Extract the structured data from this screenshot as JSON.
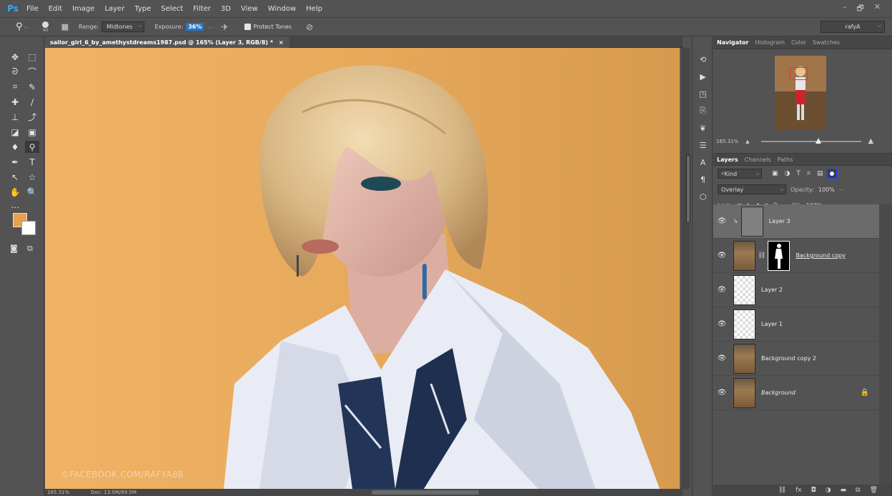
{
  "app": {
    "logo": "Ps"
  },
  "menu": [
    "File",
    "Edit",
    "Image",
    "Layer",
    "Type",
    "Select",
    "Filter",
    "3D",
    "View",
    "Window",
    "Help"
  ],
  "window_controls": [
    "–",
    "🗗",
    "✕"
  ],
  "options": {
    "brush_size": "40",
    "range_label": "Range:",
    "range_value": "Midtones",
    "exposure_label": "Exposure:",
    "exposure_value": "36%",
    "protect_tones": "Protect Tones",
    "workspace": "rafyA"
  },
  "document": {
    "tab_title": "sailor_girl_6_by_amethystdreams1987.psd @ 165% (Layer 3, RGB/8) *",
    "close": "×",
    "watermark": "©FACEBOOK.COM/RAFYA88",
    "zoom": "165.31%",
    "doc_size": "Doc: 13.0M/89.5M"
  },
  "colors": {
    "foreground": "#e8a14e",
    "background": "#ffffff",
    "selection_highlight": "#1c3cff"
  },
  "navigator": {
    "tabs": [
      "Navigator",
      "Histogram",
      "Color",
      "Swatches"
    ],
    "active_tab": "Navigator",
    "zoom": "165.31%"
  },
  "layers_panel": {
    "tabs": [
      "Layers",
      "Channels",
      "Paths"
    ],
    "active_tab": "Layers",
    "filter_kind": "Kind",
    "blend_mode": "Overlay",
    "opacity_label": "Opacity:",
    "opacity_value": "100%",
    "lock_label": "Lock:",
    "fill_label": "Fill:",
    "fill_value": "100%",
    "layers": [
      {
        "name": "Layer 3"
      },
      {
        "name": "Background copy"
      },
      {
        "name": "Layer 2"
      },
      {
        "name": "Layer 1"
      },
      {
        "name": "Background copy 2"
      },
      {
        "name": "Background"
      }
    ]
  }
}
